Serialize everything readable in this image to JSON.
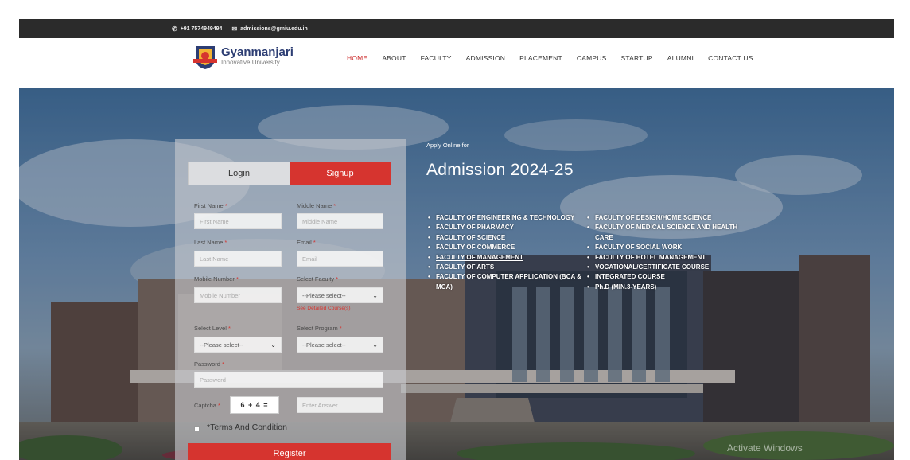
{
  "topbar": {
    "phone": "+91 7574949494",
    "email": "admissions@gmiu.edu.in"
  },
  "brand": {
    "name": "Gyanmanjari",
    "tagline": "Innovative University"
  },
  "nav": {
    "home": "HOME",
    "about": "ABOUT",
    "faculty": "FACULTY",
    "admission": "ADMISSION",
    "placement": "PLACEMENT",
    "campus": "CAMPUS",
    "startup": "STARTUP",
    "alumni": "ALUMNI",
    "contact": "CONTACT US"
  },
  "form": {
    "tab_login": "Login",
    "tab_signup": "Signup",
    "first_name_label": "First Name",
    "first_name_placeholder": "First Name",
    "middle_name_label": "Middle Name",
    "middle_name_placeholder": "Middle Name",
    "last_name_label": "Last Name",
    "last_name_placeholder": "Last Name",
    "email_label": "Email",
    "email_placeholder": "Email",
    "mobile_label": "Mobile Number",
    "mobile_placeholder": "Mobile Number",
    "faculty_label": "Select Faculty",
    "faculty_value": "--Please select--",
    "detailed_courses_link": "See Detailed Course(s)",
    "level_label": "Select Level",
    "level_value": "--Please select--",
    "program_label": "Select Program",
    "program_value": "--Please select--",
    "password_label": "Password",
    "password_placeholder": "Password",
    "captcha_label": "Captcha",
    "captcha_question": "6 + 4 =",
    "captcha_placeholder": "Enter Answer",
    "terms": "*Terms And Condition",
    "register": "Register",
    "required_mark": "*"
  },
  "hero": {
    "apply_online": "Apply Online for",
    "title": "Admission 2024-25",
    "faculties_left": [
      "FACULTY OF ENGINEERING & TECHNOLOGY",
      "FACULTY OF PHARMACY",
      "FACULTY OF SCIENCE",
      "FACULTY OF COMMERCE",
      "FACULTY OF MANAGEMENT",
      "FACULTY OF ARTS",
      "FACULTY OF COMPUTER APPLICATION (BCA & MCA)"
    ],
    "faculties_right": [
      "FACULTY OF DESIGN/HOME SCIENCE",
      "FACULTY OF MEDICAL SCIENCE AND HEALTH CARE",
      "FACULTY OF SOCIAL WORK",
      "FACULTY OF HOTEL MANAGEMENT",
      "VOCATIONAL/CERTIFICATE COURSE",
      "INTEGRATED COURSE",
      "Ph.D (MIN.3-YEARS)"
    ]
  },
  "watermark": "Activate Windows",
  "colors": {
    "brand_red": "#d6342f",
    "brand_navy": "#2c3d73",
    "topbar": "#2b2b2b"
  }
}
